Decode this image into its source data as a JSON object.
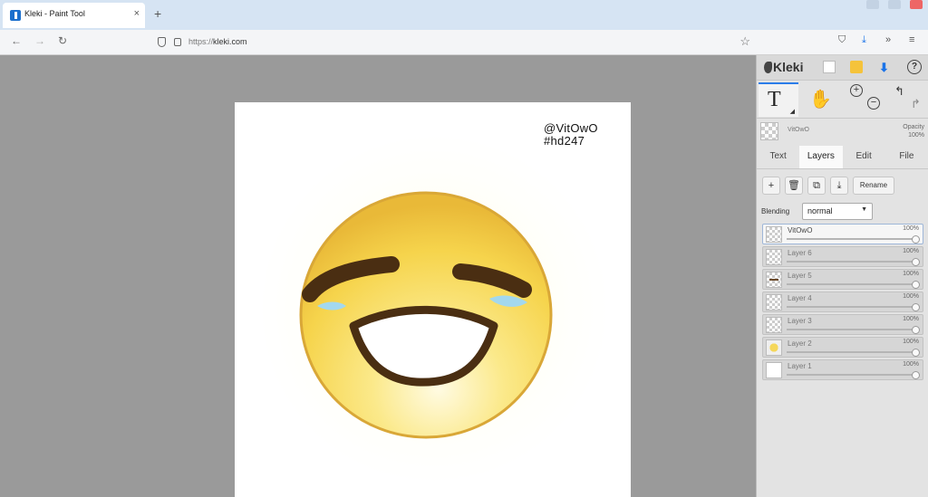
{
  "browser": {
    "tab_title": "Kleki - Paint Tool",
    "tab_close": "×",
    "new_tab": "+",
    "url_prefix": "https://",
    "url_host": "kleki.com",
    "back": "←",
    "forward": "→",
    "reload": "↻",
    "bookmark": "☆",
    "shield_btn": "⛉",
    "downloads_btn": "⤓",
    "more_btn": "»",
    "menu_btn": "≡"
  },
  "canvas": {
    "signature_line1": "@VitOwO",
    "signature_line2": "#hd247"
  },
  "panel": {
    "logo": "Kleki",
    "help": "?",
    "save_icon": "⬇",
    "text_tool": "T",
    "text_tool_caret": "◢",
    "hand_tool": "✋",
    "zoom_in": "+",
    "zoom_out": "−",
    "undo": "↰",
    "redo": "↱",
    "selected_layer_name": "VitOwO",
    "opacity_label": "Opacity",
    "opacity_value": "100%",
    "tabs": [
      "Text",
      "Layers",
      "Edit",
      "File"
    ],
    "active_tab": "Layers",
    "buttons": {
      "add": "+",
      "delete": "🗑",
      "duplicate": "⧉",
      "merge": "⤓",
      "rename": "Rename"
    },
    "blending_label": "Blending",
    "blending_value": "normal",
    "layers": [
      {
        "name": "VitOwO",
        "opacity": "100%",
        "thumb": "checker",
        "active": true
      },
      {
        "name": "Layer 6",
        "opacity": "100%",
        "thumb": "checker",
        "active": false
      },
      {
        "name": "Layer 5",
        "opacity": "100%",
        "thumb": "dash",
        "active": false
      },
      {
        "name": "Layer 4",
        "opacity": "100%",
        "thumb": "checker",
        "active": false
      },
      {
        "name": "Layer 3",
        "opacity": "100%",
        "thumb": "checker",
        "active": false
      },
      {
        "name": "Layer 2",
        "opacity": "100%",
        "thumb": "yellow",
        "active": false
      },
      {
        "name": "Layer 1",
        "opacity": "100%",
        "thumb": "white",
        "active": false
      }
    ]
  },
  "colors": {
    "accent": "#2b7de9",
    "workspace": "#9a9a9a",
    "panel": "#e3e3e3",
    "emoji_face": "#f7d34d",
    "eyebrow": "#4a2e12",
    "tear": "#9fd7ef"
  }
}
